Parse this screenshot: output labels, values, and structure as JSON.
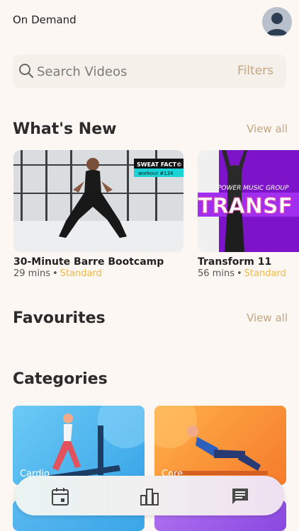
{
  "header": {
    "title": "On Demand"
  },
  "search": {
    "placeholder": "Search Videos",
    "filters_label": "Filters"
  },
  "whats_new": {
    "title": "What's New",
    "view_all": "View all",
    "videos": [
      {
        "title": "30-Minute Barre Bootcamp",
        "duration": "29 mins",
        "separator": "•",
        "tier": "Standard",
        "badge_line1": "SWEAT FACT©",
        "badge_line2": "workout #134"
      },
      {
        "title": "Transform 11",
        "duration": "56 mins",
        "separator": "•",
        "tier": "Standard",
        "banner_small": "POWER MUSIC GROUP",
        "banner_big": "TRANSF"
      }
    ]
  },
  "favourites": {
    "title": "Favourites",
    "view_all": "View all"
  },
  "categories": {
    "title": "Categories",
    "items": [
      {
        "label": "Cardio"
      },
      {
        "label": "Core"
      }
    ]
  },
  "bottom_nav": {
    "items": [
      {
        "icon": "calendar-icon"
      },
      {
        "icon": "bar-chart-icon"
      },
      {
        "icon": "chat-icon"
      }
    ]
  },
  "colors": {
    "accent": "#c4a581",
    "tier": "#f1b84a",
    "background": "#fcf7f2"
  }
}
